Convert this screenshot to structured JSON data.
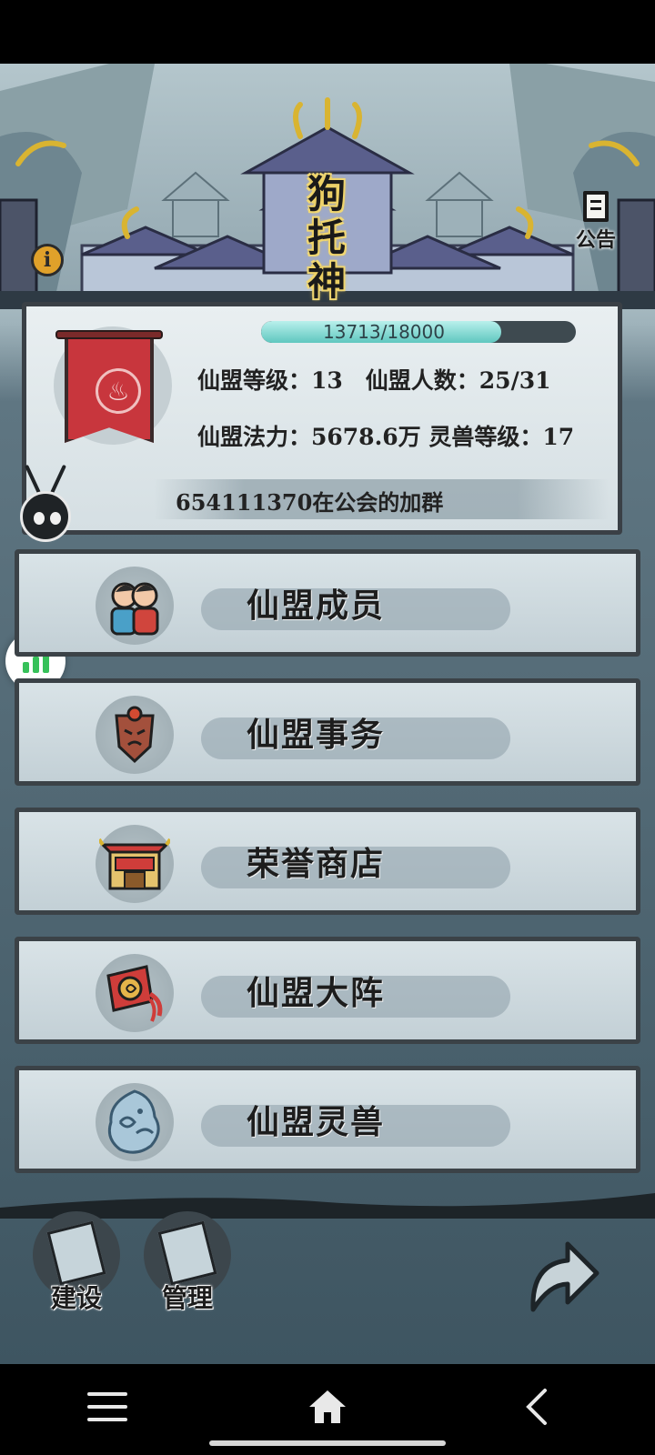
{
  "guild": {
    "name_chars": [
      "狗",
      "托",
      "神"
    ],
    "xp_text": "13713/18000",
    "xp_fraction": 0.762,
    "row1": "仙盟等级：13　仙盟人数：25/31",
    "row2": "仙盟法力：5678.6万 灵兽等级：17",
    "notice": "654111370在公会的加群"
  },
  "header": {
    "info_label": "i",
    "notice_button_label": "公告"
  },
  "menu": {
    "items": [
      {
        "label": "仙盟成员",
        "icon": "members-icon"
      },
      {
        "label": "仙盟事务",
        "icon": "shield-mask-icon"
      },
      {
        "label": "荣誉商店",
        "icon": "shop-gate-icon"
      },
      {
        "label": "仙盟大阵",
        "icon": "array-banner-icon"
      },
      {
        "label": "仙盟灵兽",
        "icon": "spirit-beast-icon"
      }
    ]
  },
  "bottom": {
    "build_label": "建设",
    "manage_label": "管理"
  },
  "colors": {
    "accent_gold": "#e6c24a",
    "banner_red": "#c8363d",
    "xp_teal": "#5fc7bf",
    "float_green": "#37c15a"
  }
}
